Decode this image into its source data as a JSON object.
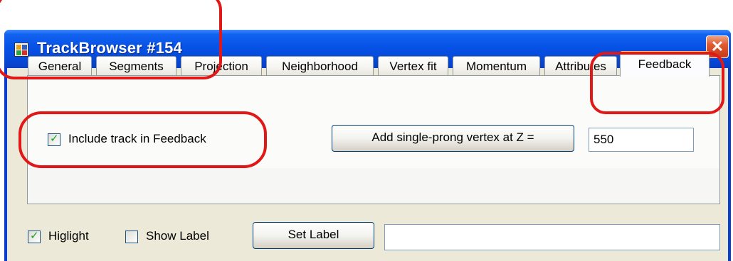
{
  "window": {
    "title": "TrackBrowser #154",
    "close_glyph": "✕"
  },
  "tabs": [
    {
      "label": "General",
      "active": false
    },
    {
      "label": "Segments",
      "active": false
    },
    {
      "label": "Projection",
      "active": false
    },
    {
      "label": "Neighborhood",
      "active": false
    },
    {
      "label": "Vertex fit",
      "active": false
    },
    {
      "label": "Momentum",
      "active": false
    },
    {
      "label": "Attributes",
      "active": false
    },
    {
      "label": "Feedback",
      "active": true
    }
  ],
  "feedback_panel": {
    "include_checkbox": {
      "label": "Include track in Feedback",
      "checked": true
    },
    "add_vertex_button": "Add single-prong vertex at Z =",
    "z_value": "550"
  },
  "bottom_bar": {
    "highlight": {
      "label": "Higlight",
      "checked": true
    },
    "show_label": {
      "label": "Show Label",
      "checked": false
    },
    "set_label_button": "Set Label",
    "label_value": ""
  },
  "icons": {
    "app": "app-window-icon",
    "close": "close-icon",
    "check": "checkmark-icon"
  },
  "colors": {
    "titlebar": "#0752e6",
    "close_button": "#e05a30",
    "client_bg": "#ece9d8",
    "active_tab_highlight": "#ffc83c",
    "checkmark": "#21a121",
    "annotation": "#e01818"
  }
}
